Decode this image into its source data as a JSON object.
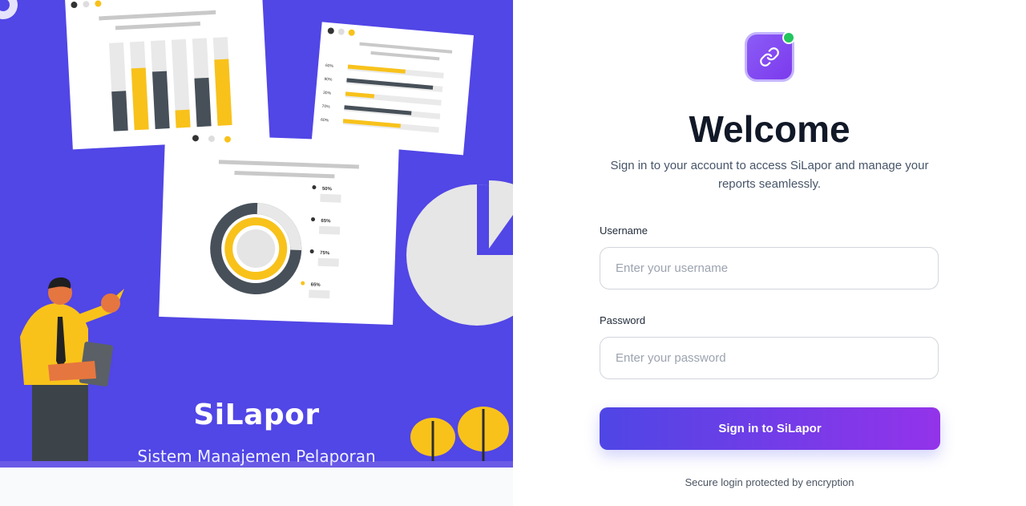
{
  "brand": {
    "name": "SiLapor",
    "tagline": "Sistem Manajemen Pelaporan",
    "accent": "#5146e6"
  },
  "illustration": {
    "bar_card": {
      "values": [
        45,
        70,
        65,
        20,
        55,
        75
      ]
    },
    "progress_card": {
      "rows": [
        {
          "label": "60%",
          "value": 60
        },
        {
          "label": "90%",
          "value": 90
        },
        {
          "label": "30%",
          "value": 30
        },
        {
          "label": "70%",
          "value": 70
        },
        {
          "label": "60%",
          "value": 60
        }
      ]
    },
    "donut_card": {
      "labels": [
        "50%",
        "65%",
        "75%",
        "65%"
      ]
    }
  },
  "login": {
    "logo_icon": "link-icon",
    "title": "Welcome",
    "subtitle": "Sign in to your account to access SiLapor and manage your reports seamlessly.",
    "username_label": "Username",
    "username_placeholder": "Enter your username",
    "password_label": "Password",
    "password_placeholder": "Enter your password",
    "submit_label": "Sign in to SiLapor",
    "secure_note": "Secure login protected by encryption",
    "button_gradient": [
      "#4f46e5",
      "#9333ea"
    ],
    "status_color": "#22c55e"
  }
}
